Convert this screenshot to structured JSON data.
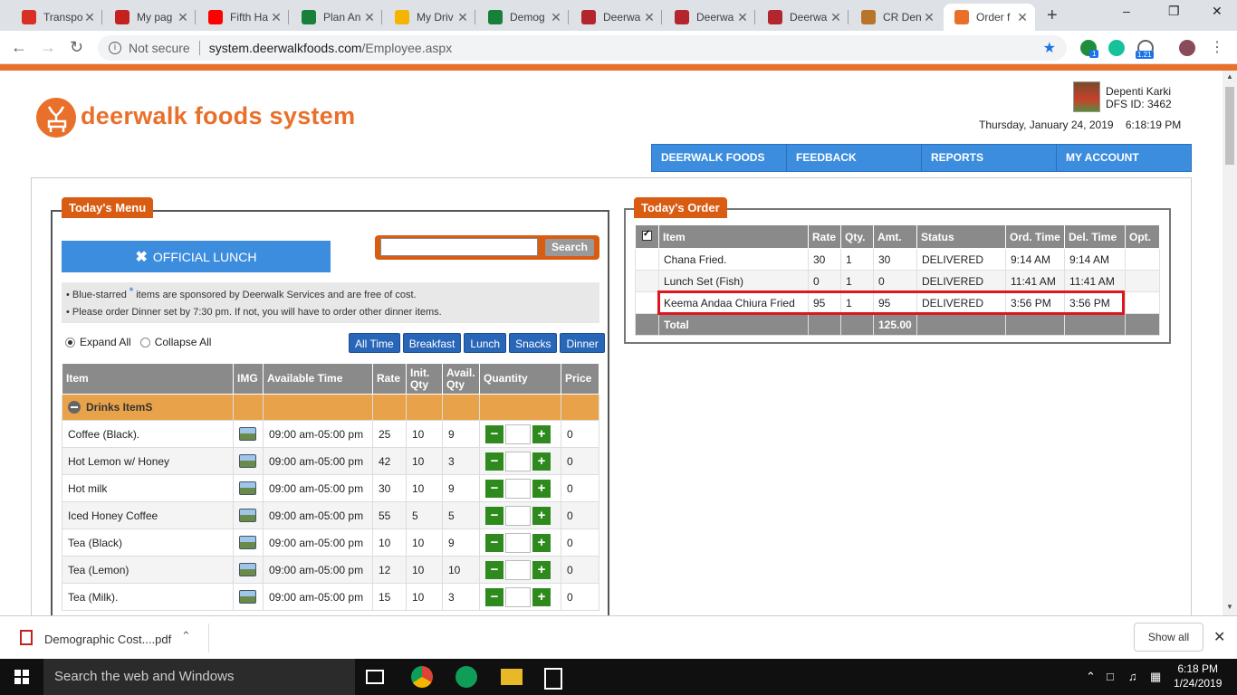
{
  "browser": {
    "tabs": [
      {
        "label": "Transpo",
        "icon": "gmail-icon"
      },
      {
        "label": "My pag",
        "icon": "dashboard-icon"
      },
      {
        "label": "Fifth Ha",
        "icon": "youtube-icon"
      },
      {
        "label": "Plan An",
        "icon": "sheets-icon"
      },
      {
        "label": "My Driv",
        "icon": "drive-icon"
      },
      {
        "label": "Demog",
        "icon": "sheets-icon"
      },
      {
        "label": "Deerwa",
        "icon": "deerwalk-icon"
      },
      {
        "label": "Deerwa",
        "icon": "deerwalk-icon"
      },
      {
        "label": "Deerwa",
        "icon": "deerwalk-icon"
      },
      {
        "label": "CR Den",
        "icon": "reindeer-icon"
      },
      {
        "label": "Order f",
        "icon": "deerwalk-foods-icon"
      }
    ],
    "security_label": "Not secure",
    "url_host": "system.deerwalkfoods.com",
    "url_path": "/Employee.aspx",
    "ext_badge_1": "1",
    "ext_badge_2": "1.21"
  },
  "site": {
    "logo_text": "deerwalk foods system",
    "user_name": "Depenti Karki",
    "user_id": "DFS ID: 3462",
    "datetime": "Thursday, January 24, 2019    6:18:19 PM",
    "nav": [
      "DEERWALK FOODS",
      "FEEDBACK",
      "REPORTS",
      "MY ACCOUNT"
    ],
    "accent_color": "#e8702a",
    "nav_color": "#3c8dde"
  },
  "menu": {
    "panel_title": "Today's Menu",
    "official_lunch": "OFFICIAL LUNCH",
    "search_placeholder": "",
    "search_button": "Search",
    "note1_a": "• Blue-starred ",
    "note1_star": "*",
    "note1_b": " items are sponsored by Deerwalk Services and are free of cost.",
    "note2": "• Please order Dinner set by 7:30 pm. If not, you will have to order other dinner items.",
    "expand_all": "Expand All",
    "collapse_all": "Collapse All",
    "filters": [
      "All Time",
      "Breakfast",
      "Lunch",
      "Snacks",
      "Dinner"
    ],
    "columns": [
      "Item",
      "IMG",
      "Available Time",
      "Rate",
      "Init. Qty",
      "Avail. Qty",
      "Quantity",
      "Price"
    ],
    "category": "Drinks ItemS",
    "items": [
      {
        "name": "Coffee (Black).",
        "time": "09:00 am-05:00 pm",
        "rate": "25",
        "init": "10",
        "avail": "9",
        "price": "0"
      },
      {
        "name": "Hot Lemon w/ Honey",
        "time": "09:00 am-05:00 pm",
        "rate": "42",
        "init": "10",
        "avail": "3",
        "price": "0"
      },
      {
        "name": "Hot milk",
        "time": "09:00 am-05:00 pm",
        "rate": "30",
        "init": "10",
        "avail": "9",
        "price": "0"
      },
      {
        "name": "Iced Honey Coffee",
        "time": "09:00 am-05:00 pm",
        "rate": "55",
        "init": "5",
        "avail": "5",
        "price": "0"
      },
      {
        "name": "Tea (Black)",
        "time": "09:00 am-05:00 pm",
        "rate": "10",
        "init": "10",
        "avail": "9",
        "price": "0"
      },
      {
        "name": "Tea (Lemon)",
        "time": "09:00 am-05:00 pm",
        "rate": "12",
        "init": "10",
        "avail": "10",
        "price": "0"
      },
      {
        "name": "Tea (Milk).",
        "time": "09:00 am-05:00 pm",
        "rate": "15",
        "init": "10",
        "avail": "3",
        "price": "0"
      }
    ]
  },
  "order": {
    "panel_title": "Today's Order",
    "columns": [
      "Item",
      "Rate",
      "Qty.",
      "Amt.",
      "Status",
      "Ord. Time",
      "Del. Time",
      "Opt."
    ],
    "rows": [
      {
        "item": "Chana Fried.",
        "rate": "30",
        "qty": "1",
        "amt": "30",
        "status": "DELIVERED",
        "ord": "9:14 AM",
        "del": "9:14 AM"
      },
      {
        "item": "Lunch Set (Fish)",
        "rate": "0",
        "qty": "1",
        "amt": "0",
        "status": "DELIVERED",
        "ord": "11:41 AM",
        "del": "11:41 AM"
      },
      {
        "item": "Keema Andaa Chiura Fried",
        "rate": "95",
        "qty": "1",
        "amt": "95",
        "status": "DELIVERED",
        "ord": "3:56 PM",
        "del": "3:56 PM"
      }
    ],
    "total_label": "Total",
    "total_amount": "125.00",
    "highlight_color": "#e0161e"
  },
  "download": {
    "filename": "Demographic Cost....pdf",
    "show_all": "Show all"
  },
  "taskbar": {
    "search": "Search the web and Windows",
    "time": "6:18 PM",
    "date": "1/24/2019"
  }
}
